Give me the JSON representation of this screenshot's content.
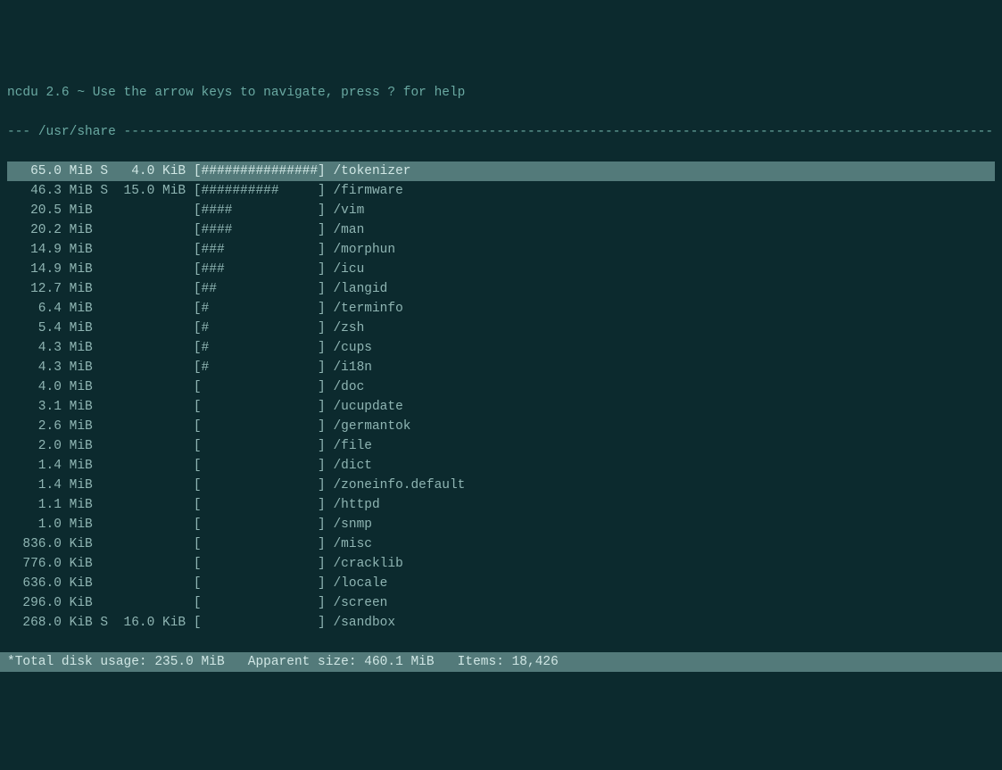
{
  "header": {
    "text": "ncdu 2.6 ~ Use the arrow keys to navigate, press ? for help"
  },
  "breadcrumb": {
    "prefix": "--- ",
    "path": "/usr/share",
    "suffix": " ----------------------------------------------------------------------------------------------------------------"
  },
  "rows": [
    {
      "size": "  65.0 MiB",
      "flag": "S",
      "apparent": "  4.0 KiB",
      "bar": "###############",
      "name": "/tokenizer",
      "selected": true
    },
    {
      "size": "  46.3 MiB",
      "flag": "S",
      "apparent": " 15.0 MiB",
      "bar": "##########     ",
      "name": "/firmware",
      "selected": false
    },
    {
      "size": "  20.5 MiB",
      "flag": " ",
      "apparent": "         ",
      "bar": "####           ",
      "name": "/vim",
      "selected": false
    },
    {
      "size": "  20.2 MiB",
      "flag": " ",
      "apparent": "         ",
      "bar": "####           ",
      "name": "/man",
      "selected": false
    },
    {
      "size": "  14.9 MiB",
      "flag": " ",
      "apparent": "         ",
      "bar": "###            ",
      "name": "/morphun",
      "selected": false
    },
    {
      "size": "  14.9 MiB",
      "flag": " ",
      "apparent": "         ",
      "bar": "###            ",
      "name": "/icu",
      "selected": false
    },
    {
      "size": "  12.7 MiB",
      "flag": " ",
      "apparent": "         ",
      "bar": "##             ",
      "name": "/langid",
      "selected": false
    },
    {
      "size": "   6.4 MiB",
      "flag": " ",
      "apparent": "         ",
      "bar": "#              ",
      "name": "/terminfo",
      "selected": false
    },
    {
      "size": "   5.4 MiB",
      "flag": " ",
      "apparent": "         ",
      "bar": "#              ",
      "name": "/zsh",
      "selected": false
    },
    {
      "size": "   4.3 MiB",
      "flag": " ",
      "apparent": "         ",
      "bar": "#              ",
      "name": "/cups",
      "selected": false
    },
    {
      "size": "   4.3 MiB",
      "flag": " ",
      "apparent": "         ",
      "bar": "#              ",
      "name": "/i18n",
      "selected": false
    },
    {
      "size": "   4.0 MiB",
      "flag": " ",
      "apparent": "         ",
      "bar": "               ",
      "name": "/doc",
      "selected": false
    },
    {
      "size": "   3.1 MiB",
      "flag": " ",
      "apparent": "         ",
      "bar": "               ",
      "name": "/ucupdate",
      "selected": false
    },
    {
      "size": "   2.6 MiB",
      "flag": " ",
      "apparent": "         ",
      "bar": "               ",
      "name": "/germantok",
      "selected": false
    },
    {
      "size": "   2.0 MiB",
      "flag": " ",
      "apparent": "         ",
      "bar": "               ",
      "name": "/file",
      "selected": false
    },
    {
      "size": "   1.4 MiB",
      "flag": " ",
      "apparent": "         ",
      "bar": "               ",
      "name": "/dict",
      "selected": false
    },
    {
      "size": "   1.4 MiB",
      "flag": " ",
      "apparent": "         ",
      "bar": "               ",
      "name": "/zoneinfo.default",
      "selected": false
    },
    {
      "size": "   1.1 MiB",
      "flag": " ",
      "apparent": "         ",
      "bar": "               ",
      "name": "/httpd",
      "selected": false
    },
    {
      "size": "   1.0 MiB",
      "flag": " ",
      "apparent": "         ",
      "bar": "               ",
      "name": "/snmp",
      "selected": false
    },
    {
      "size": " 836.0 KiB",
      "flag": " ",
      "apparent": "         ",
      "bar": "               ",
      "name": "/misc",
      "selected": false
    },
    {
      "size": " 776.0 KiB",
      "flag": " ",
      "apparent": "         ",
      "bar": "               ",
      "name": "/cracklib",
      "selected": false
    },
    {
      "size": " 636.0 KiB",
      "flag": " ",
      "apparent": "         ",
      "bar": "               ",
      "name": "/locale",
      "selected": false
    },
    {
      "size": " 296.0 KiB",
      "flag": " ",
      "apparent": "         ",
      "bar": "               ",
      "name": "/screen",
      "selected": false
    },
    {
      "size": " 268.0 KiB",
      "flag": "S",
      "apparent": " 16.0 KiB",
      "bar": "               ",
      "name": "/sandbox",
      "selected": false
    }
  ],
  "footer": {
    "text": "*Total disk usage: 235.0 MiB   Apparent size: 460.1 MiB   Items: 18,426                                               "
  }
}
